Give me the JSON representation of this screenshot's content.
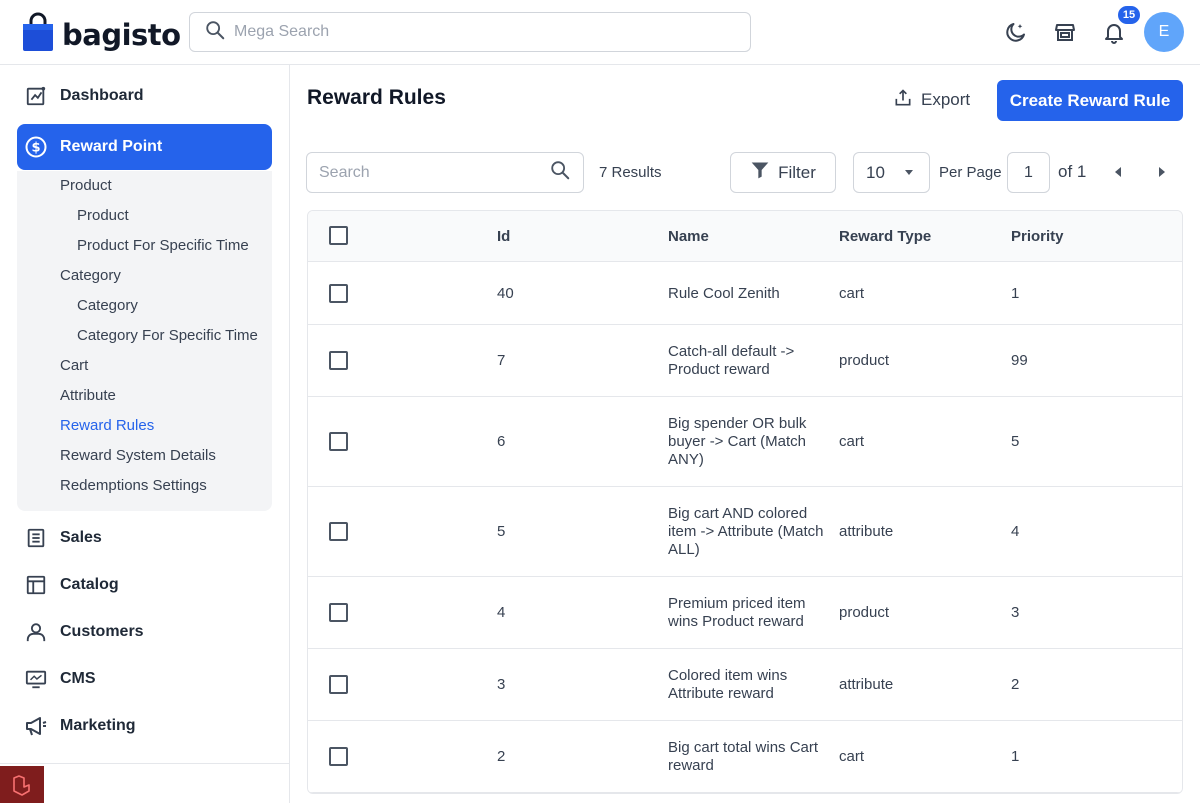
{
  "header": {
    "brand": "bagisto",
    "search_placeholder": "Mega Search",
    "notification_count": "15",
    "avatar_initial": "E"
  },
  "sidebar": {
    "dashboard": "Dashboard",
    "reward_point": "Reward Point",
    "sub": {
      "product_group": "Product",
      "product": "Product",
      "product_specific_time": "Product For Specific Time",
      "category_group": "Category",
      "category": "Category",
      "category_specific_time": "Category For Specific Time",
      "cart": "Cart",
      "attribute": "Attribute",
      "reward_rules": "Reward Rules",
      "reward_system_details": "Reward System Details",
      "redemptions_settings": "Redemptions Settings"
    },
    "sales": "Sales",
    "catalog": "Catalog",
    "customers": "Customers",
    "cms": "CMS",
    "marketing": "Marketing"
  },
  "main": {
    "title": "Reward Rules",
    "export_label": "Export",
    "create_label": "Create Reward Rule",
    "search_placeholder": "Search",
    "results": "7 Results",
    "filter_label": "Filter",
    "per_page_value": "10",
    "per_page_label": "Per Page",
    "page_value": "1",
    "of_label": "of 1"
  },
  "table": {
    "columns": {
      "id": "Id",
      "name": "Name",
      "reward_type": "Reward Type",
      "priority": "Priority"
    },
    "rows": [
      {
        "id": "40",
        "name": "Rule Cool Zenith",
        "type": "cart",
        "priority": "1"
      },
      {
        "id": "7",
        "name": "Catch-all default -> Product reward",
        "type": "product",
        "priority": "99"
      },
      {
        "id": "6",
        "name": "Big spender OR bulk buyer -> Cart (Match ANY)",
        "type": "cart",
        "priority": "5"
      },
      {
        "id": "5",
        "name": "Big cart AND colored item -> Attribute (Match ALL)",
        "type": "attribute",
        "priority": "4"
      },
      {
        "id": "4",
        "name": "Premium priced item wins Product reward",
        "type": "product",
        "priority": "3"
      },
      {
        "id": "3",
        "name": "Colored item wins Attribute reward",
        "type": "attribute",
        "priority": "2"
      },
      {
        "id": "2",
        "name": "Big cart total wins Cart reward",
        "type": "cart",
        "priority": "1"
      }
    ]
  },
  "colors": {
    "accent": "#2563eb",
    "avatar": "#60a5fa"
  }
}
